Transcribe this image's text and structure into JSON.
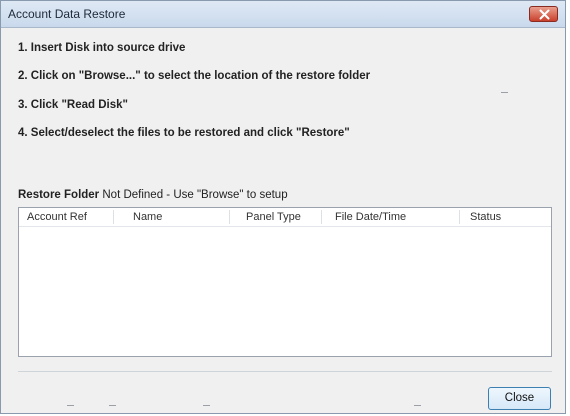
{
  "window": {
    "title": "Account Data Restore",
    "close_icon": "close-icon",
    "title_close_color": "#c9402c"
  },
  "instructions": [
    "1. Insert Disk into source drive",
    "2. Click on \"Browse...\" to select the location of the restore folder",
    "3. Click \"Read Disk\"",
    "4. Select/deselect the files to be restored and click \"Restore\""
  ],
  "restore_folder": {
    "label": "Restore Folder",
    "value": "Not Defined - Use \"Browse\" to setup"
  },
  "file_list": {
    "columns": [
      "Account Ref",
      "Name",
      "Panel Type",
      "File Date/Time",
      "Status"
    ],
    "rows": []
  },
  "buttons": {
    "close_label": "Close"
  }
}
